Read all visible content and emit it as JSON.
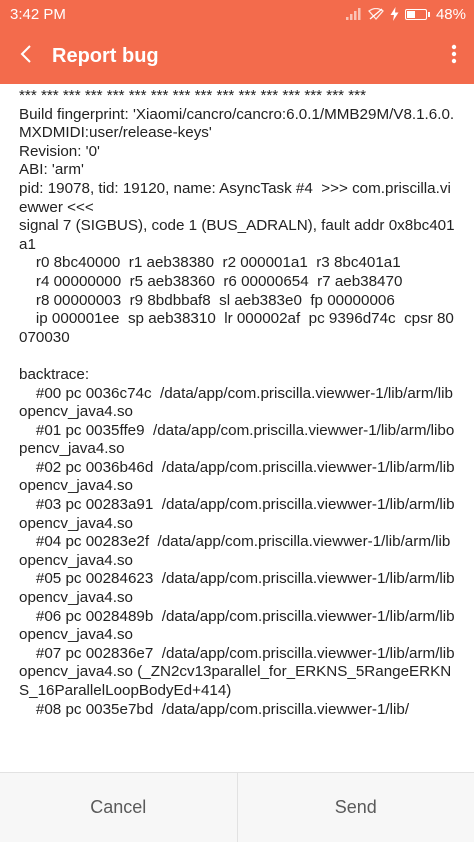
{
  "status_bar": {
    "time": "3:42 PM",
    "battery_text": "48%",
    "battery_level": 0.48,
    "icons": [
      "signal-icon",
      "wifi-off-icon",
      "charging-icon",
      "battery-icon"
    ]
  },
  "app_bar": {
    "title": "Report bug",
    "back_icon": "chevron-left-icon",
    "menu_icon": "more-vert-icon"
  },
  "log": [
    "*** *** *** *** *** *** *** *** *** *** *** *** *** *** *** ***",
    "Build fingerprint: 'Xiaomi/cancro/cancro:6.0.1/MMB29M/V8.1.6.0.MXDMIDI:user/release-keys'",
    "Revision: '0'",
    "ABI: 'arm'",
    "pid: 19078, tid: 19120, name: AsyncTask #4  >>> com.priscilla.viewwer <<<",
    "signal 7 (SIGBUS), code 1 (BUS_ADRALN), fault addr 0x8bc401a1",
    "    r0 8bc40000  r1 aeb38380  r2 000001a1  r3 8bc401a1",
    "    r4 00000000  r5 aeb38360  r6 00000654  r7 aeb38470",
    "    r8 00000003  r9 8bdbbaf8  sl aeb383e0  fp 00000006",
    "    ip 000001ee  sp aeb38310  lr 000002af  pc 9396d74c  cpsr 80070030",
    "",
    "backtrace:",
    "    #00 pc 0036c74c  /data/app/com.priscilla.viewwer-1/lib/arm/libopencv_java4.so",
    "    #01 pc 0035ffe9  /data/app/com.priscilla.viewwer-1/lib/arm/libopencv_java4.so",
    "    #02 pc 0036b46d  /data/app/com.priscilla.viewwer-1/lib/arm/libopencv_java4.so",
    "    #03 pc 00283a91  /data/app/com.priscilla.viewwer-1/lib/arm/libopencv_java4.so",
    "    #04 pc 00283e2f  /data/app/com.priscilla.viewwer-1/lib/arm/libopencv_java4.so",
    "    #05 pc 00284623  /data/app/com.priscilla.viewwer-1/lib/arm/libopencv_java4.so",
    "    #06 pc 0028489b  /data/app/com.priscilla.viewwer-1/lib/arm/libopencv_java4.so",
    "    #07 pc 002836e7  /data/app/com.priscilla.viewwer-1/lib/arm/libopencv_java4.so (_ZN2cv13parallel_for_ERKNS_5RangeERKNS_16ParallelLoopBodyEd+414)",
    "    #08 pc 0035e7bd  /data/app/com.priscilla.viewwer-1/lib/"
  ],
  "buttons": {
    "cancel": "Cancel",
    "send": "Send"
  }
}
